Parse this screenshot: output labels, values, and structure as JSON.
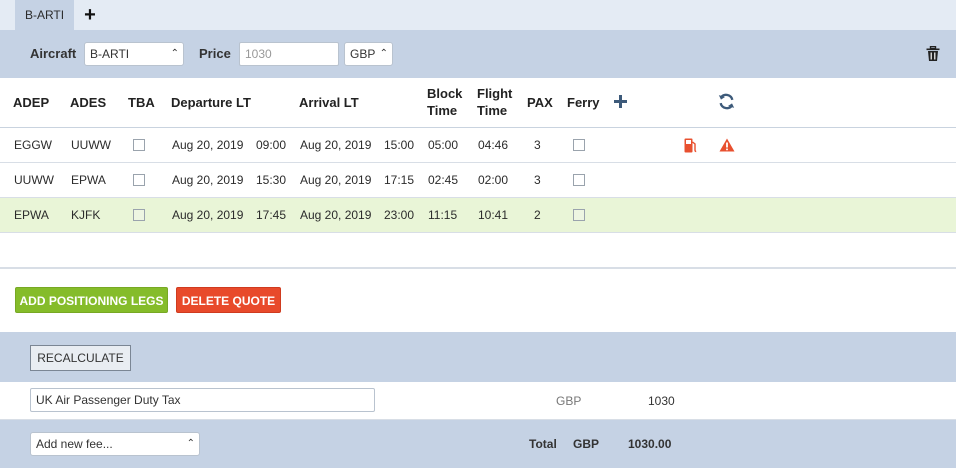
{
  "tabs": [
    {
      "label": "B-ARTI"
    }
  ],
  "aircraft_bar": {
    "aircraft_label": "Aircraft",
    "aircraft_value": "B-ARTI",
    "price_label": "Price",
    "price_placeholder": "1030",
    "currency_value": "GBP"
  },
  "legs_table": {
    "headers": {
      "adep": "ADEP",
      "ades": "ADES",
      "tba": "TBA",
      "departure": "Departure LT",
      "arrival": "Arrival LT",
      "block_line1": "Block",
      "block_line2": "Time",
      "flight_line1": "Flight",
      "flight_line2": "Time",
      "pax": "PAX",
      "ferry": "Ferry"
    },
    "rows": [
      {
        "adep": "EGGW",
        "ades": "UUWW",
        "dep_date": "Aug 20, 2019",
        "dep_time": "09:00",
        "arr_date": "Aug 20, 2019",
        "arr_time": "15:00",
        "block": "05:00",
        "flight": "04:46",
        "pax": "3",
        "icons": [
          "fuel-icon",
          "warning-icon"
        ]
      },
      {
        "adep": "UUWW",
        "ades": "EPWA",
        "dep_date": "Aug 20, 2019",
        "dep_time": "15:30",
        "arr_date": "Aug 20, 2019",
        "arr_time": "17:15",
        "block": "02:45",
        "flight": "02:00",
        "pax": "3"
      },
      {
        "adep": "EPWA",
        "ades": "KJFK",
        "dep_date": "Aug 20, 2019",
        "dep_time": "17:45",
        "arr_date": "Aug 20, 2019",
        "arr_time": "23:00",
        "block": "11:15",
        "flight": "10:41",
        "pax": "2"
      }
    ]
  },
  "actions": {
    "add_positioning": "ADD POSITIONING LEGS",
    "delete_quote": "DELETE QUOTE",
    "recalculate": "RECALCULATE"
  },
  "fees": [
    {
      "name": "UK Air Passenger Duty Tax",
      "currency": "GBP",
      "amount": "1030"
    }
  ],
  "footer": {
    "add_fee_placeholder": "Add new fee...",
    "total_label": "Total",
    "total_currency": "GBP",
    "total_amount": "1030.00"
  },
  "colors": {
    "accent_green": "#85bc2a",
    "accent_red": "#e84a2b",
    "panel_blue": "#c5d2e4",
    "highlight_row": "#e9f5d7",
    "icon_blue": "#3d5a7a",
    "warning_red": "#e8502f"
  }
}
